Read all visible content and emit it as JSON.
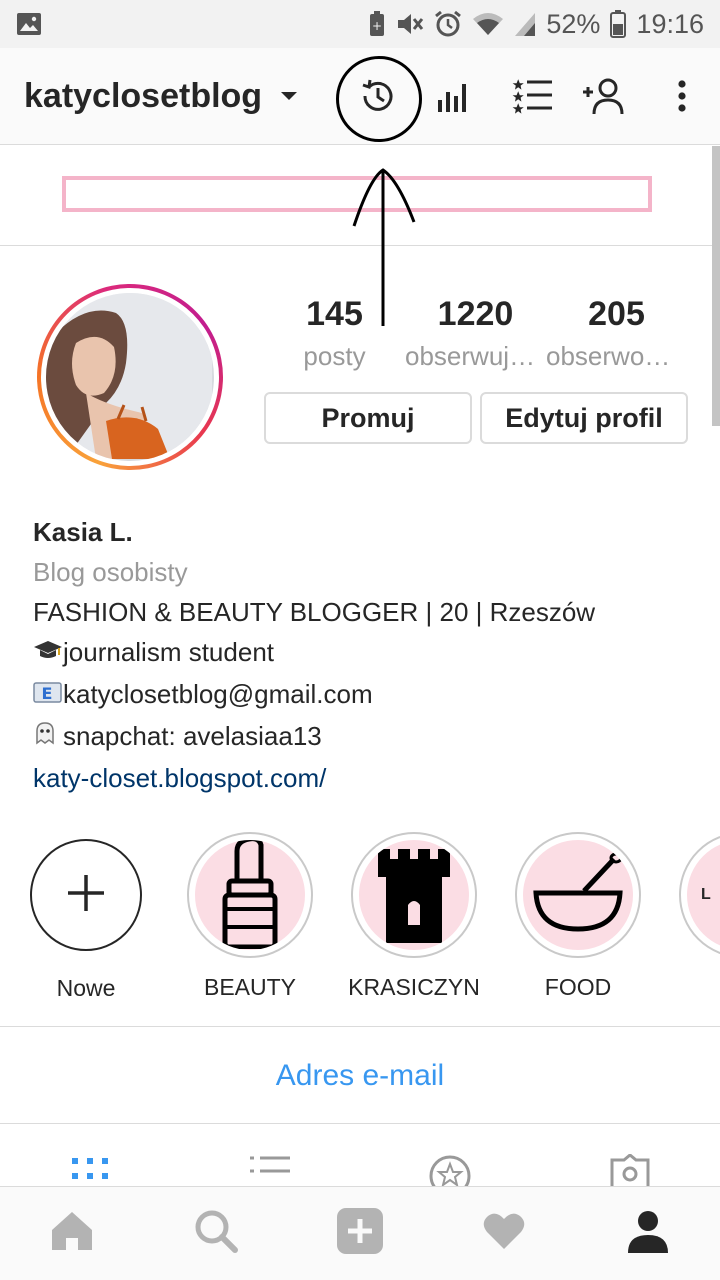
{
  "status_bar": {
    "battery": "52%",
    "time": "19:16"
  },
  "header": {
    "username": "katyclosetblog",
    "icons": [
      "chevron-down-icon",
      "history-icon",
      "insights-icon",
      "close-friends-icon",
      "add-person-icon",
      "more-icon"
    ]
  },
  "profile": {
    "stats": [
      {
        "value": "145",
        "label": "posty"
      },
      {
        "value": "1220",
        "label": "obserwujących"
      },
      {
        "value": "205",
        "label": "obserwowanych"
      }
    ],
    "buttons": {
      "promote": "Promuj",
      "edit": "Edytuj profil"
    },
    "name": "Kasia L.",
    "category": "Blog osobisty",
    "bio_lines": [
      "FASHION & BEAUTY BLOGGER | 20 | Rzeszów",
      "journalism student",
      "katyclosetblog@gmail.com",
      "snapchat: avelasiaa13"
    ],
    "link": "katy-closet.blogspot.com/"
  },
  "highlights": [
    {
      "label": "Nowe",
      "icon": "plus-icon"
    },
    {
      "label": "BEAUTY",
      "icon": "lipstick-icon"
    },
    {
      "label": "KRASICZYN",
      "icon": "castle-tower-icon"
    },
    {
      "label": "FOOD",
      "icon": "mixing-bowl-icon"
    },
    {
      "label": "L",
      "icon": "letter-l-icon"
    }
  ],
  "contact": {
    "email_button": "Adres e-mail"
  },
  "colors": {
    "accent_blue": "#3897f0",
    "link_blue": "#003569",
    "highlight_pink": "#fbdde4",
    "banner_pink": "#f4b4c9"
  },
  "bottom_nav": [
    "home-icon",
    "search-icon",
    "add-post-icon",
    "heart-icon",
    "profile-icon"
  ]
}
